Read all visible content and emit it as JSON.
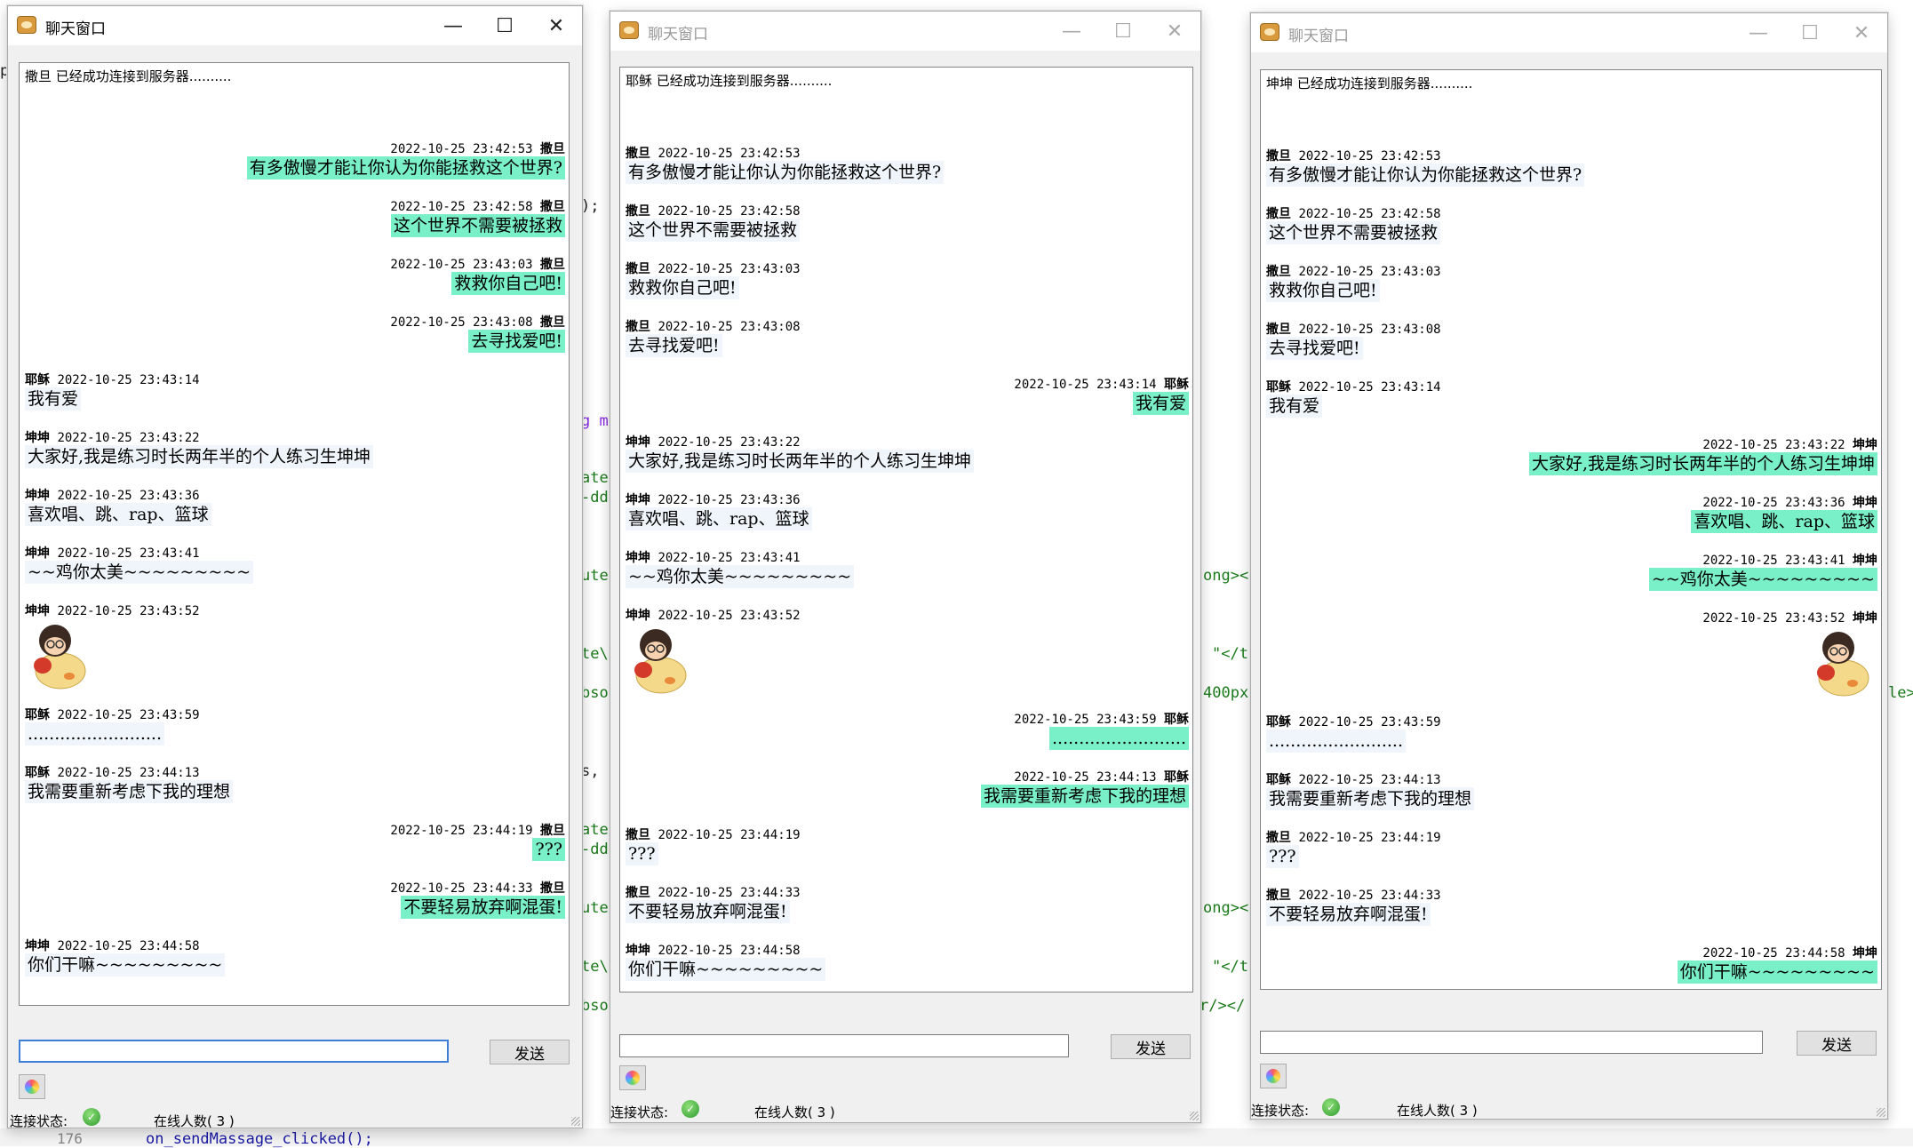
{
  "background_editor": {
    "fragments": [
      "p",
      ");",
      "g m",
      "ate",
      "-dd",
      "ute",
      "te\\",
      "bso",
      "s,",
      "ate",
      "-dd",
      "ute",
      "te\\",
      "bso",
      "ong><",
      "\"</t",
      "400px",
      "ong><",
      "\"</t",
      "r/></",
      "le>",
      "on_sendMassage_clicked();"
    ],
    "line_number": "176"
  },
  "windows": [
    {
      "title": "聊天窗口",
      "active": true,
      "connection_message": "撒旦 已经成功连接到服务器..........",
      "messages": [
        {
          "side": "right",
          "sender": "撒旦",
          "time": "2022-10-25 23:42:53",
          "text": "有多傲慢才能让你认为你能拯救这个世界?"
        },
        {
          "side": "right",
          "sender": "撒旦",
          "time": "2022-10-25 23:42:58",
          "text": "这个世界不需要被拯救"
        },
        {
          "side": "right",
          "sender": "撒旦",
          "time": "2022-10-25 23:43:03",
          "text": "救救你自己吧!"
        },
        {
          "side": "right",
          "sender": "撒旦",
          "time": "2022-10-25 23:43:08",
          "text": "去寻找爱吧!"
        },
        {
          "side": "left",
          "sender": "耶稣",
          "time": "2022-10-25 23:43:14",
          "text": "我有爱"
        },
        {
          "side": "left",
          "sender": "坤坤",
          "time": "2022-10-25 23:43:22",
          "text": "大家好,我是练习时长两年半的个人练习生坤坤"
        },
        {
          "side": "left",
          "sender": "坤坤",
          "time": "2022-10-25 23:43:36",
          "text": "喜欢唱、跳、rap、篮球"
        },
        {
          "side": "left",
          "sender": "坤坤",
          "time": "2022-10-25 23:43:41",
          "text": "~~鸡你太美~~~~~~~~~"
        },
        {
          "side": "left",
          "sender": "坤坤",
          "time": "2022-10-25 23:43:52",
          "sticker": "chick-sticker"
        },
        {
          "side": "left",
          "sender": "耶稣",
          "time": "2022-10-25 23:43:59",
          "text": "........................."
        },
        {
          "side": "left",
          "sender": "耶稣",
          "time": "2022-10-25 23:44:13",
          "text": "我需要重新考虑下我的理想"
        },
        {
          "side": "right",
          "sender": "撒旦",
          "time": "2022-10-25 23:44:19",
          "text": "???"
        },
        {
          "side": "right",
          "sender": "撒旦",
          "time": "2022-10-25 23:44:33",
          "text": "不要轻易放弃啊混蛋!"
        },
        {
          "side": "left",
          "sender": "坤坤",
          "time": "2022-10-25 23:44:58",
          "text": "你们干嘛~~~~~~~~~"
        }
      ],
      "input_value": "",
      "send_label": "发送",
      "status_label": "连接状态:",
      "online_label": "在线人数( 3 )"
    },
    {
      "title": "聊天窗口",
      "active": false,
      "connection_message": "耶稣 已经成功连接到服务器..........",
      "messages": [
        {
          "side": "left",
          "sender": "撒旦",
          "time": "2022-10-25 23:42:53",
          "text": "有多傲慢才能让你认为你能拯救这个世界?"
        },
        {
          "side": "left",
          "sender": "撒旦",
          "time": "2022-10-25 23:42:58",
          "text": "这个世界不需要被拯救"
        },
        {
          "side": "left",
          "sender": "撒旦",
          "time": "2022-10-25 23:43:03",
          "text": "救救你自己吧!"
        },
        {
          "side": "left",
          "sender": "撒旦",
          "time": "2022-10-25 23:43:08",
          "text": "去寻找爱吧!"
        },
        {
          "side": "right",
          "sender": "耶稣",
          "time": "2022-10-25 23:43:14",
          "text": "我有爱"
        },
        {
          "side": "left",
          "sender": "坤坤",
          "time": "2022-10-25 23:43:22",
          "text": "大家好,我是练习时长两年半的个人练习生坤坤"
        },
        {
          "side": "left",
          "sender": "坤坤",
          "time": "2022-10-25 23:43:36",
          "text": "喜欢唱、跳、rap、篮球"
        },
        {
          "side": "left",
          "sender": "坤坤",
          "time": "2022-10-25 23:43:41",
          "text": "~~鸡你太美~~~~~~~~~"
        },
        {
          "side": "left",
          "sender": "坤坤",
          "time": "2022-10-25 23:43:52",
          "sticker": "chick-sticker"
        },
        {
          "side": "right",
          "sender": "耶稣",
          "time": "2022-10-25 23:43:59",
          "text": "........................."
        },
        {
          "side": "right",
          "sender": "耶稣",
          "time": "2022-10-25 23:44:13",
          "text": "我需要重新考虑下我的理想"
        },
        {
          "side": "left",
          "sender": "撒旦",
          "time": "2022-10-25 23:44:19",
          "text": "???"
        },
        {
          "side": "left",
          "sender": "撒旦",
          "time": "2022-10-25 23:44:33",
          "text": "不要轻易放弃啊混蛋!"
        },
        {
          "side": "left",
          "sender": "坤坤",
          "time": "2022-10-25 23:44:58",
          "text": "你们干嘛~~~~~~~~~"
        }
      ],
      "input_value": "",
      "send_label": "发送",
      "status_label": "连接状态:",
      "online_label": "在线人数( 3 )"
    },
    {
      "title": "聊天窗口",
      "active": false,
      "connection_message": "坤坤 已经成功连接到服务器..........",
      "messages": [
        {
          "side": "left",
          "sender": "撒旦",
          "time": "2022-10-25 23:42:53",
          "text": "有多傲慢才能让你认为你能拯救这个世界?"
        },
        {
          "side": "left",
          "sender": "撒旦",
          "time": "2022-10-25 23:42:58",
          "text": "这个世界不需要被拯救"
        },
        {
          "side": "left",
          "sender": "撒旦",
          "time": "2022-10-25 23:43:03",
          "text": "救救你自己吧!"
        },
        {
          "side": "left",
          "sender": "撒旦",
          "time": "2022-10-25 23:43:08",
          "text": "去寻找爱吧!"
        },
        {
          "side": "left",
          "sender": "耶稣",
          "time": "2022-10-25 23:43:14",
          "text": "我有爱"
        },
        {
          "side": "right",
          "sender": "坤坤",
          "time": "2022-10-25 23:43:22",
          "text": "大家好,我是练习时长两年半的个人练习生坤坤"
        },
        {
          "side": "right",
          "sender": "坤坤",
          "time": "2022-10-25 23:43:36",
          "text": "喜欢唱、跳、rap、篮球"
        },
        {
          "side": "right",
          "sender": "坤坤",
          "time": "2022-10-25 23:43:41",
          "text": "~~鸡你太美~~~~~~~~~"
        },
        {
          "side": "right",
          "sender": "坤坤",
          "time": "2022-10-25 23:43:52",
          "sticker": "chick-sticker"
        },
        {
          "side": "left",
          "sender": "耶稣",
          "time": "2022-10-25 23:43:59",
          "text": "........................."
        },
        {
          "side": "left",
          "sender": "耶稣",
          "time": "2022-10-25 23:44:13",
          "text": "我需要重新考虑下我的理想"
        },
        {
          "side": "left",
          "sender": "撒旦",
          "time": "2022-10-25 23:44:19",
          "text": "???"
        },
        {
          "side": "left",
          "sender": "撒旦",
          "time": "2022-10-25 23:44:33",
          "text": "不要轻易放弃啊混蛋!"
        },
        {
          "side": "right",
          "sender": "坤坤",
          "time": "2022-10-25 23:44:58",
          "text": "你们干嘛~~~~~~~~~"
        }
      ],
      "input_value": "",
      "send_label": "发送",
      "status_label": "连接状态:",
      "online_label": "在线人数( 3 )"
    }
  ],
  "colors": {
    "own_bubble": "#7af0c8",
    "other_bubble": "#f0f5fb",
    "status_online": "#2e9a2e"
  }
}
